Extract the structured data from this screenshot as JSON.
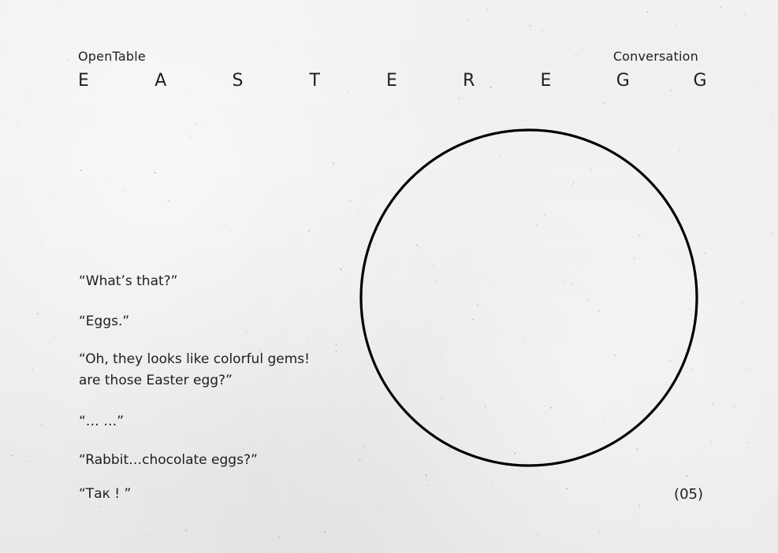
{
  "header": {
    "brand": "OpenTable",
    "section": "Conversation",
    "title_letters": [
      "E",
      "A",
      "S",
      "T",
      "E",
      "R",
      "E",
      "G",
      "G"
    ]
  },
  "dialogue": {
    "lines": [
      "“What’s that?”",
      "“Eggs.”",
      "“Oh, they looks like colorful gems!",
      "are those Easter egg?”",
      "“… …”",
      "“Rabbit…chocolate eggs?”",
      "“Так ! ”"
    ]
  },
  "footer": {
    "page_number": "(05)"
  },
  "colors": {
    "background": "#ededeb",
    "ink": "#1e1e1e",
    "circle_stroke": "#000000"
  }
}
